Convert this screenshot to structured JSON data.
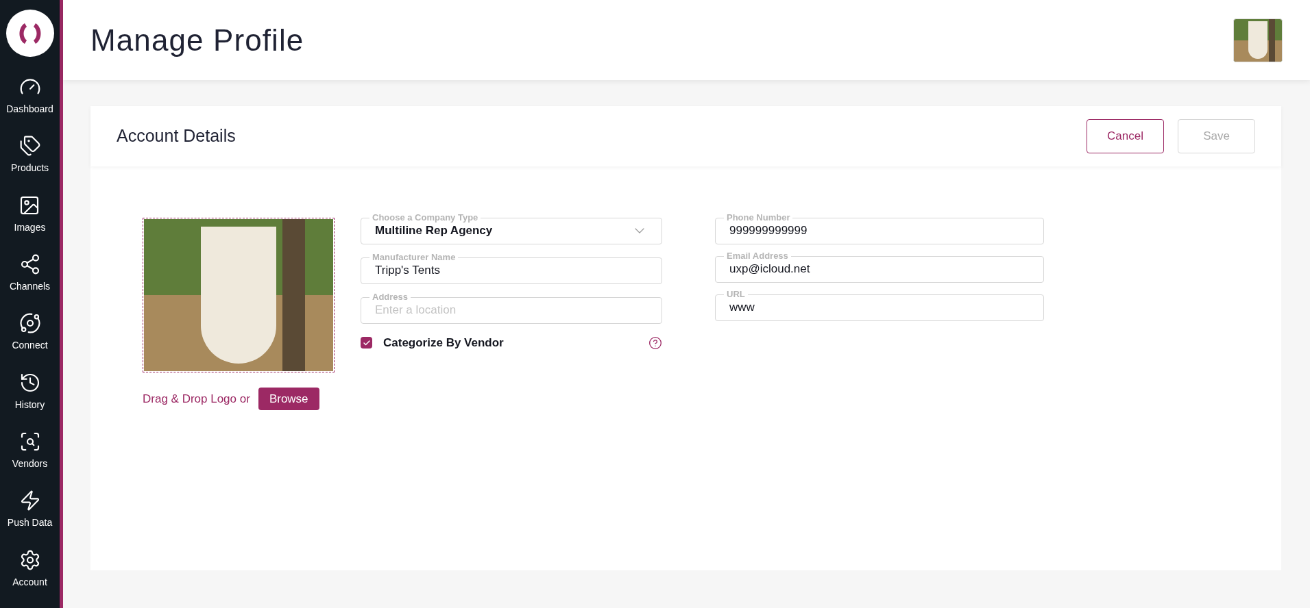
{
  "sidebar": {
    "items": [
      {
        "label": "Dashboard"
      },
      {
        "label": "Products"
      },
      {
        "label": "Images"
      },
      {
        "label": "Channels"
      },
      {
        "label": "Connect"
      },
      {
        "label": "History"
      },
      {
        "label": "Vendors"
      },
      {
        "label": "Push Data"
      },
      {
        "label": "Account"
      }
    ]
  },
  "header": {
    "title": "Manage Profile"
  },
  "card": {
    "title": "Account Details",
    "buttons": [
      {
        "label": "Cancel",
        "disabled": false
      },
      {
        "label": "Save",
        "disabled": true
      }
    ],
    "logo": {
      "hint": "Drag & Drop Logo or",
      "button": "Browse"
    },
    "left_fields": [
      {
        "kind": "select",
        "label": "Choose a Company Type",
        "value": "Multiline Rep Agency"
      },
      {
        "kind": "text",
        "label": "Manufacturer Name",
        "value": "Tripp's Tents"
      },
      {
        "kind": "text",
        "label": "Address",
        "placeholder": "Enter a location"
      }
    ],
    "checkbox": {
      "label": "Categorize By Vendor",
      "checked": true
    },
    "right_fields": [
      {
        "label": "Phone Number",
        "value": "999999999999"
      },
      {
        "label": "Email Address",
        "value": "uxp@icloud.net"
      },
      {
        "label": "URL",
        "value": "www"
      }
    ]
  }
}
